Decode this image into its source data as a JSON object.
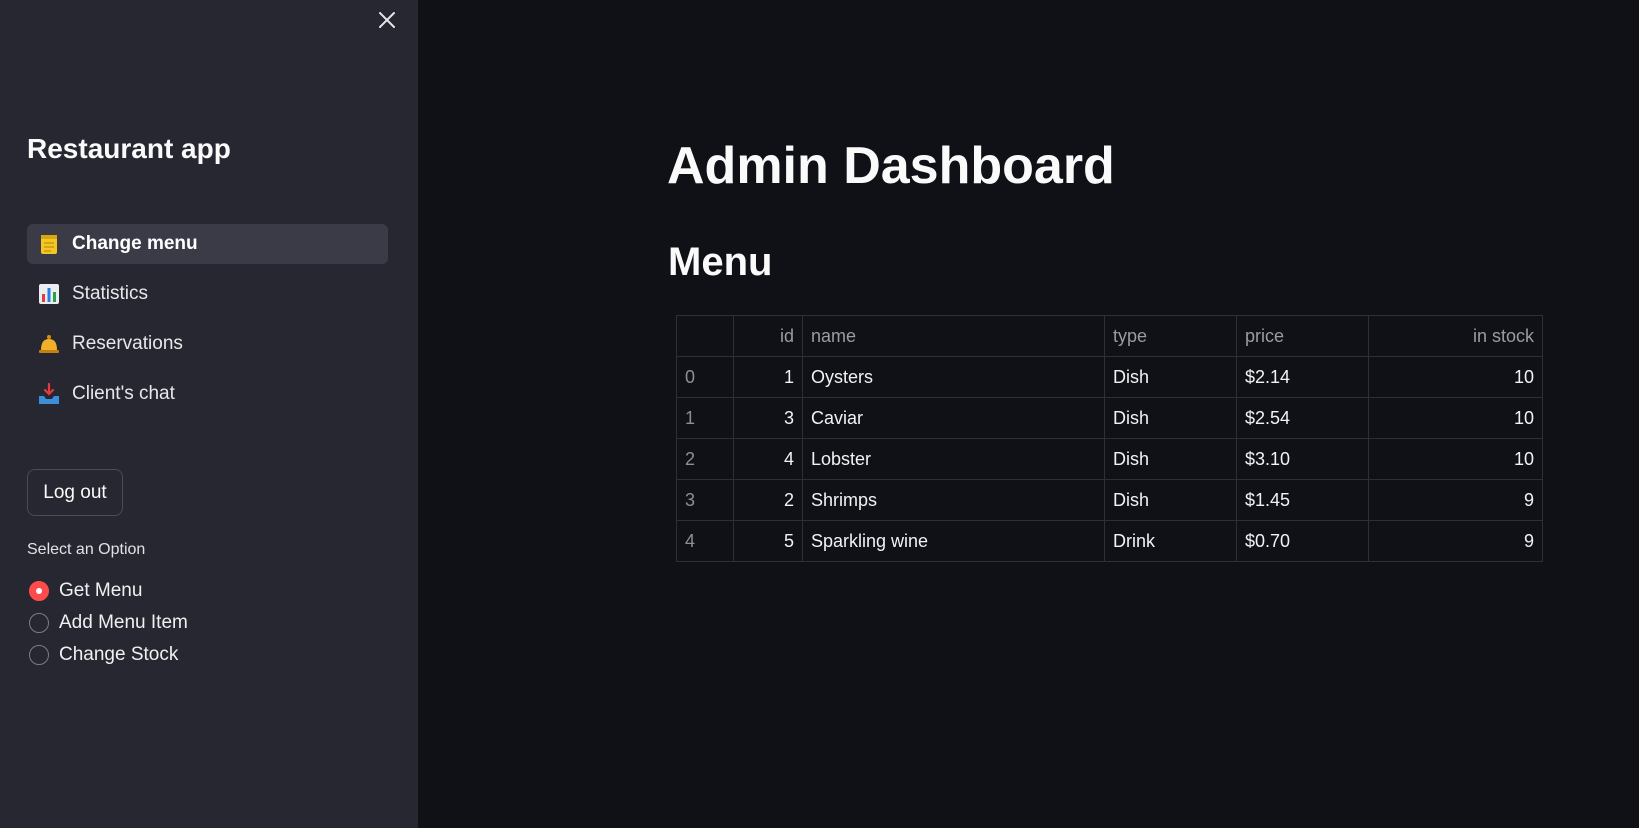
{
  "sidebar": {
    "app_title": "Restaurant app",
    "nav": [
      {
        "icon": "notepad-icon",
        "label": "Change menu",
        "active": true
      },
      {
        "icon": "bar-chart-icon",
        "label": "Statistics",
        "active": false
      },
      {
        "icon": "bell-icon",
        "label": "Reservations",
        "active": false
      },
      {
        "icon": "inbox-tray-icon",
        "label": "Client's chat",
        "active": false
      }
    ],
    "logout_label": "Log out",
    "radio_label": "Select an Option",
    "radio_options": [
      {
        "label": "Get Menu",
        "checked": true
      },
      {
        "label": "Add Menu Item",
        "checked": false
      },
      {
        "label": "Change Stock",
        "checked": false
      }
    ]
  },
  "main": {
    "title": "Admin Dashboard",
    "section_title": "Menu",
    "table": {
      "columns": [
        "",
        "id",
        "name",
        "type",
        "price",
        "in stock"
      ],
      "rows": [
        [
          "0",
          "1",
          "Oysters",
          "Dish",
          "$2.14",
          "10"
        ],
        [
          "1",
          "3",
          "Caviar",
          "Dish",
          "$2.54",
          "10"
        ],
        [
          "2",
          "4",
          "Lobster",
          "Dish",
          "$3.10",
          "10"
        ],
        [
          "3",
          "2",
          "Shrimps",
          "Dish",
          "$1.45",
          "9"
        ],
        [
          "4",
          "5",
          "Sparkling wine",
          "Drink",
          "$0.70",
          "9"
        ]
      ]
    }
  },
  "colors": {
    "sidebar_bg": "#262730",
    "main_bg": "#0f1117",
    "accent": "#ff4b4b"
  }
}
